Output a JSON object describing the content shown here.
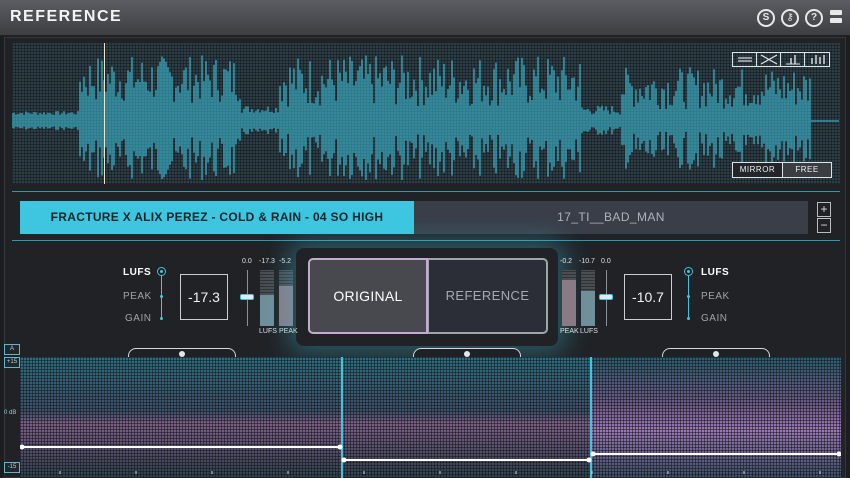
{
  "header": {
    "title": "REFERENCE",
    "icons": [
      {
        "name": "s-icon",
        "glyph": "S"
      },
      {
        "name": "key-icon",
        "glyph": "⚷"
      },
      {
        "name": "help-icon",
        "glyph": "?"
      },
      {
        "name": "menu-icon",
        "glyph": ""
      }
    ]
  },
  "waveform": {
    "mode_buttons": [
      "MIRROR",
      "FREE"
    ],
    "view_buttons": [
      "align-view-icon",
      "cross-view-icon",
      "small-bars-icon",
      "large-bars-icon"
    ],
    "color": "#3ec6e0"
  },
  "tracks": {
    "active": "FRACTURE X ALIX PEREZ - COLD & RAIN - 04 SO HIGH",
    "inactive": "17_TI__BAD_MAN",
    "add": "+",
    "remove": "−"
  },
  "left": {
    "modes": [
      "LUFS",
      "PEAK",
      "GAIN"
    ],
    "selected": "LUFS",
    "value": "-17.3",
    "gain_scale": "0.0",
    "meter_values": [
      "-17.3",
      "-5.2"
    ],
    "meter_labels": [
      "LUFS",
      "PEAK"
    ],
    "meter_levels": [
      0.55,
      0.72
    ]
  },
  "right": {
    "modes": [
      "LUFS",
      "PEAK",
      "GAIN"
    ],
    "selected": "LUFS",
    "value": "-10.7",
    "gain_scale": "0.0",
    "meter_values": [
      "-0.2",
      "-10.7"
    ],
    "meter_labels": [
      "PEAK",
      "LUFS"
    ],
    "meter_levels": [
      0.82,
      0.62
    ]
  },
  "ab_switch": {
    "original": "ORIGINAL",
    "reference": "REFERENCE",
    "active": "ORIGINAL"
  },
  "lanes": {
    "side_labels": [
      "A",
      "+15",
      "-15"
    ],
    "zero_label": "0 dB"
  },
  "colors": {
    "accent": "#3ec6e0",
    "original_border": "#c8a9d6",
    "panel": "#202226"
  }
}
